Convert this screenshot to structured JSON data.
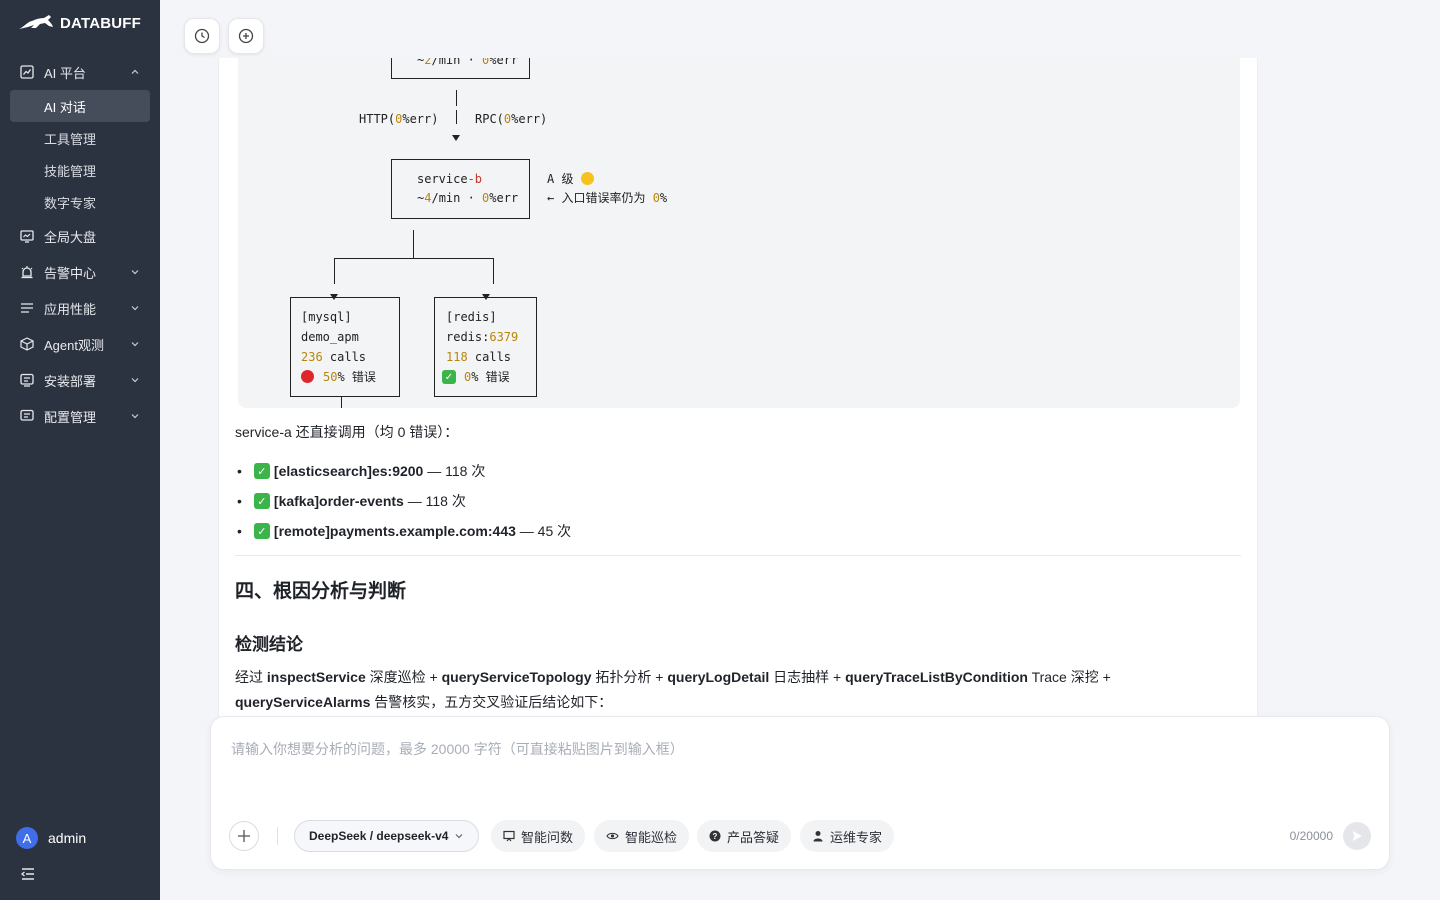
{
  "app": {
    "logo_text": "DATABUFF"
  },
  "sidebar": {
    "groups": [
      {
        "label": "AI 平台",
        "expanded": true,
        "icon": "ai-chart-icon",
        "items": [
          {
            "label": "AI 对话",
            "active": true
          },
          {
            "label": "工具管理"
          },
          {
            "label": "技能管理"
          },
          {
            "label": "数字专家"
          }
        ]
      },
      {
        "label": "全局大盘",
        "icon": "dashboard-icon"
      },
      {
        "label": "告警中心",
        "icon": "alarm-icon"
      },
      {
        "label": "应用性能",
        "icon": "performance-icon"
      },
      {
        "label": "Agent观测",
        "icon": "cube-icon"
      },
      {
        "label": "安装部署",
        "icon": "deploy-icon"
      },
      {
        "label": "配置管理",
        "icon": "config-icon"
      }
    ],
    "user": {
      "avatar_letter": "A",
      "name": "admin"
    }
  },
  "diagram": {
    "top_box_line": "~2/min · 0%err",
    "edge_http": "HTTP(0%err)",
    "edge_rpc": "RPC(0%err)",
    "service_b": {
      "name": "service-b",
      "rate": "~4/min · 0%err"
    },
    "grade_note": "A 级",
    "entry_note": "← 入口错误率仍为 0%",
    "mysql": {
      "tag": "[mysql]",
      "db": "demo_apm",
      "calls": "236 calls",
      "err": "50% 错误"
    },
    "redis": {
      "tag": "[redis]",
      "host": "redis:6379",
      "calls": "118 calls",
      "err": "0% 错误"
    }
  },
  "message": {
    "intro": "service-a 还直接调用（均 0 错误）：",
    "bullets": [
      {
        "target": "[elasticsearch]es:9200",
        "count": "— 118 次"
      },
      {
        "target": "[kafka]order-events",
        "count": "— 118 次"
      },
      {
        "target": "[remote]payments.example.com:443",
        "count": "— 45 次"
      }
    ],
    "h2": "四、根因分析与判断",
    "h3": "检测结论",
    "conclusion_line1_parts": [
      "经过 ",
      "inspectService",
      " 深度巡检 + ",
      "queryServiceTopology",
      " 拓扑分析 + ",
      "queryLogDetail",
      " 日志抽样 + ",
      "queryTraceListByCondition",
      " Trace 深挖 +"
    ],
    "conclusion_line2_parts": [
      "queryServiceAlarms",
      " 告警核实，五方交叉验证后结论如下："
    ]
  },
  "input": {
    "placeholder": "请输入你想要分析的问题，最多 20000 字符（可直接粘贴图片到输入框）",
    "model": "DeepSeek / deepseek-v4",
    "chips": [
      "智能问数",
      "智能巡检",
      "产品答疑",
      "运维专家"
    ],
    "counter": "0/20000"
  }
}
